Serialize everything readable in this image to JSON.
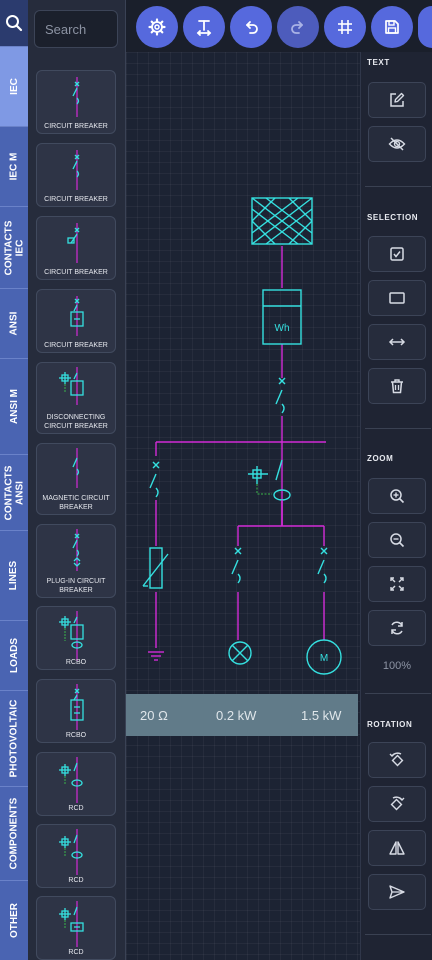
{
  "sidebar": {
    "categories": [
      {
        "label": "IEC"
      },
      {
        "label": "IEC M"
      },
      {
        "label": "CONTACTS IEC"
      },
      {
        "label": "ANSI"
      },
      {
        "label": "ANSI M"
      },
      {
        "label": "CONTACTS ANSI"
      },
      {
        "label": "LINES"
      },
      {
        "label": "LOADS"
      },
      {
        "label": "PHOTOVOLTAIC"
      },
      {
        "label": "COMPONENTS"
      },
      {
        "label": "OTHER"
      }
    ]
  },
  "palette": {
    "search_placeholder": "Search",
    "items": [
      {
        "label": "CIRCUIT BREAKER"
      },
      {
        "label": "CIRCUIT BREAKER"
      },
      {
        "label": "CIRCUIT BREAKER"
      },
      {
        "label": "CIRCUIT BREAKER"
      },
      {
        "label": "DISCONNECTING CIRCUIT BREAKER"
      },
      {
        "label": "MAGNETIC CIRCUIT BREAKER"
      },
      {
        "label": "PLUG-IN CIRCUIT BREAKER"
      },
      {
        "label": "RCBO"
      },
      {
        "label": "RCBO"
      },
      {
        "label": "RCD"
      },
      {
        "label": "RCD"
      },
      {
        "label": "RCD"
      }
    ]
  },
  "toolbar": {
    "buttons": [
      "settings-icon",
      "text-format-icon",
      "undo-icon",
      "redo-icon",
      "grid-icon",
      "save-icon"
    ]
  },
  "canvas": {
    "meter_label": "Wh",
    "motor_label": "M",
    "measurements": [
      "20 Ω",
      "0.2 kW",
      "1.5 kW"
    ]
  },
  "panel": {
    "text_title": "TEXT",
    "selection_title": "SELECTION",
    "zoom_title": "ZOOM",
    "zoom_level": "100%",
    "rotation_title": "ROTATION"
  },
  "colors": {
    "wire": "#d22bd6",
    "symbol": "#35e0e0",
    "accent": "#5669dd",
    "ground_wire": "#3ab44a"
  }
}
